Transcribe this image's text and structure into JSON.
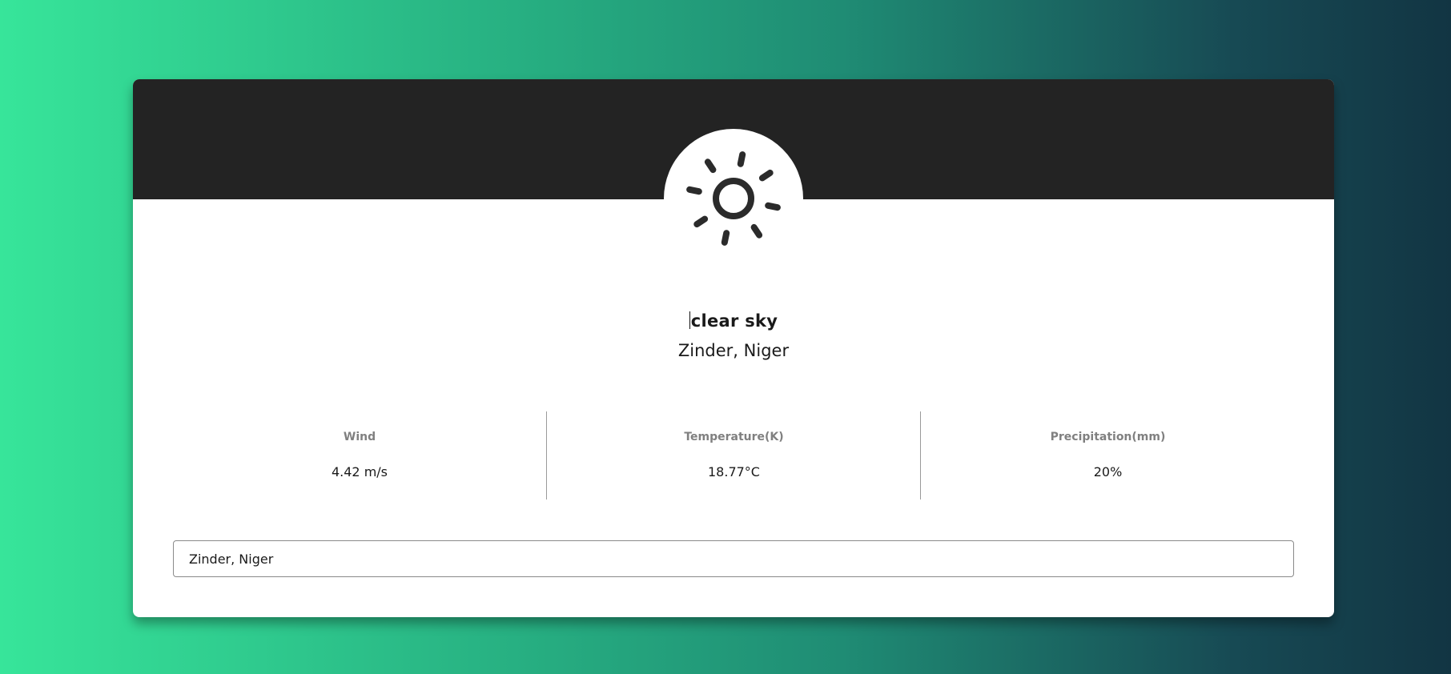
{
  "weather": {
    "icon": "sun-icon",
    "condition": "clear sky",
    "location": "Zinder, Niger"
  },
  "stats": [
    {
      "label": "Wind",
      "value": "4.42 m/s"
    },
    {
      "label": "Temperature(K)",
      "value": "18.77°C"
    },
    {
      "label": "Precipitation(mm)",
      "value": "20%"
    }
  ],
  "search": {
    "value": "Zinder, Niger"
  },
  "colors": {
    "header": "#232323",
    "card": "#ffffff",
    "gradient_start": "#37e59a",
    "gradient_end": "#123543"
  }
}
